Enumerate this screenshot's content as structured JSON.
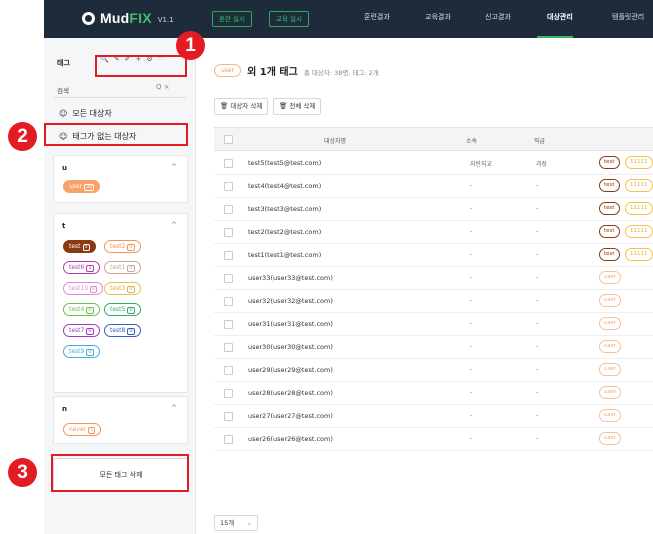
{
  "app": {
    "logo_main": "Mud",
    "logo_accent": "FIX",
    "version": "V1.1",
    "accent_color": "#35b866",
    "annotation_color": "#e31b23"
  },
  "topbar": {
    "buttons": [
      "훈련 실시",
      "교육 실시"
    ],
    "menu": [
      "훈련결과",
      "교육결과",
      "신고결과",
      "대상관리",
      "템플릿관리"
    ],
    "active": "대상관리"
  },
  "sidebar": {
    "header": "태그",
    "tool_icons": [
      "search-icon",
      "paint-icon",
      "paint-icon",
      "plus-icon",
      "gear-icon",
      "chevron-up-icon"
    ],
    "tool_glyphs": [
      "🔍",
      "✎",
      "✐",
      "+",
      "⚙",
      "^"
    ],
    "search_label": "검색",
    "search_icons": "Q  ×",
    "all_targets": "모든 대상자",
    "untagged_targets": "태그가 없는 대상자",
    "groups": [
      {
        "letter": "u",
        "tags": [
          {
            "label": "user",
            "count": "30",
            "color": "#f7a26a",
            "filled": true
          }
        ]
      },
      {
        "letter": "t",
        "tags": [
          {
            "label": "test",
            "count": "5",
            "color": "#8b3a10",
            "filled": true
          },
          {
            "label": "test2",
            "count": "0",
            "color": "#f0945a",
            "filled": false
          },
          {
            "label": "test6",
            "count": "1",
            "color": "#b23ab5",
            "filled": false
          },
          {
            "label": "test1",
            "count": "0",
            "color": "#c9a69a",
            "filled": false
          },
          {
            "label": "test10",
            "count": "0",
            "color": "#e38ad7",
            "filled": false
          },
          {
            "label": "test3",
            "count": "0",
            "color": "#e0c24a",
            "filled": false
          },
          {
            "label": "test4",
            "count": "0",
            "color": "#6ac24c",
            "filled": false
          },
          {
            "label": "test5",
            "count": "0",
            "color": "#2faa6a",
            "filled": false
          },
          {
            "label": "test7",
            "count": "0",
            "color": "#9b3ac4",
            "filled": false
          },
          {
            "label": "test8",
            "count": "0",
            "color": "#3a5ec4",
            "filled": false
          },
          {
            "label": "test9",
            "count": "0",
            "color": "#4aa8e0",
            "filled": false
          }
        ]
      },
      {
        "letter": "n",
        "tags": [
          {
            "label": "naver",
            "count": "1",
            "color": "#f0945a",
            "filled": false
          }
        ]
      }
    ],
    "delete_all_tags": "모든 태그 삭제"
  },
  "annotations": [
    "1",
    "2",
    "3"
  ],
  "main": {
    "tag_pill": "user",
    "title": "외 1개 태그",
    "subtitle": "총 대상자: 38명, 태그: 2개",
    "actions": [
      "대상자 삭제",
      "전체 삭제"
    ],
    "columns": [
      "대상자명",
      "소속",
      "직급"
    ],
    "rows": [
      {
        "name": "test5(test5@test.com)",
        "dept": "지란지교",
        "pos": "과장",
        "tags": [
          "test",
          "11111"
        ]
      },
      {
        "name": "test4(test4@test.com)",
        "dept": "-",
        "pos": "-",
        "tags": [
          "test",
          "11111"
        ]
      },
      {
        "name": "test3(test3@test.com)",
        "dept": "-",
        "pos": "-",
        "tags": [
          "test",
          "11111"
        ]
      },
      {
        "name": "test2(test2@test.com)",
        "dept": "-",
        "pos": "-",
        "tags": [
          "test",
          "11111"
        ]
      },
      {
        "name": "test1(test1@test.com)",
        "dept": "-",
        "pos": "-",
        "tags": [
          "test",
          "11111"
        ]
      },
      {
        "name": "user33(user33@test.com)",
        "dept": "-",
        "pos": "-",
        "tags": [
          "user"
        ]
      },
      {
        "name": "user32(user32@test.com)",
        "dept": "-",
        "pos": "-",
        "tags": [
          "user"
        ]
      },
      {
        "name": "user31(user31@test.com)",
        "dept": "-",
        "pos": "-",
        "tags": [
          "user"
        ]
      },
      {
        "name": "user30(user30@test.com)",
        "dept": "-",
        "pos": "-",
        "tags": [
          "user"
        ]
      },
      {
        "name": "user29(user29@test.com)",
        "dept": "-",
        "pos": "-",
        "tags": [
          "user"
        ]
      },
      {
        "name": "user28(user28@test.com)",
        "dept": "-",
        "pos": "-",
        "tags": [
          "user"
        ]
      },
      {
        "name": "user27(user27@test.com)",
        "dept": "-",
        "pos": "-",
        "tags": [
          "user"
        ]
      },
      {
        "name": "user26(user26@test.com)",
        "dept": "-",
        "pos": "-",
        "tags": [
          "user"
        ]
      }
    ],
    "page_size": "15개"
  }
}
